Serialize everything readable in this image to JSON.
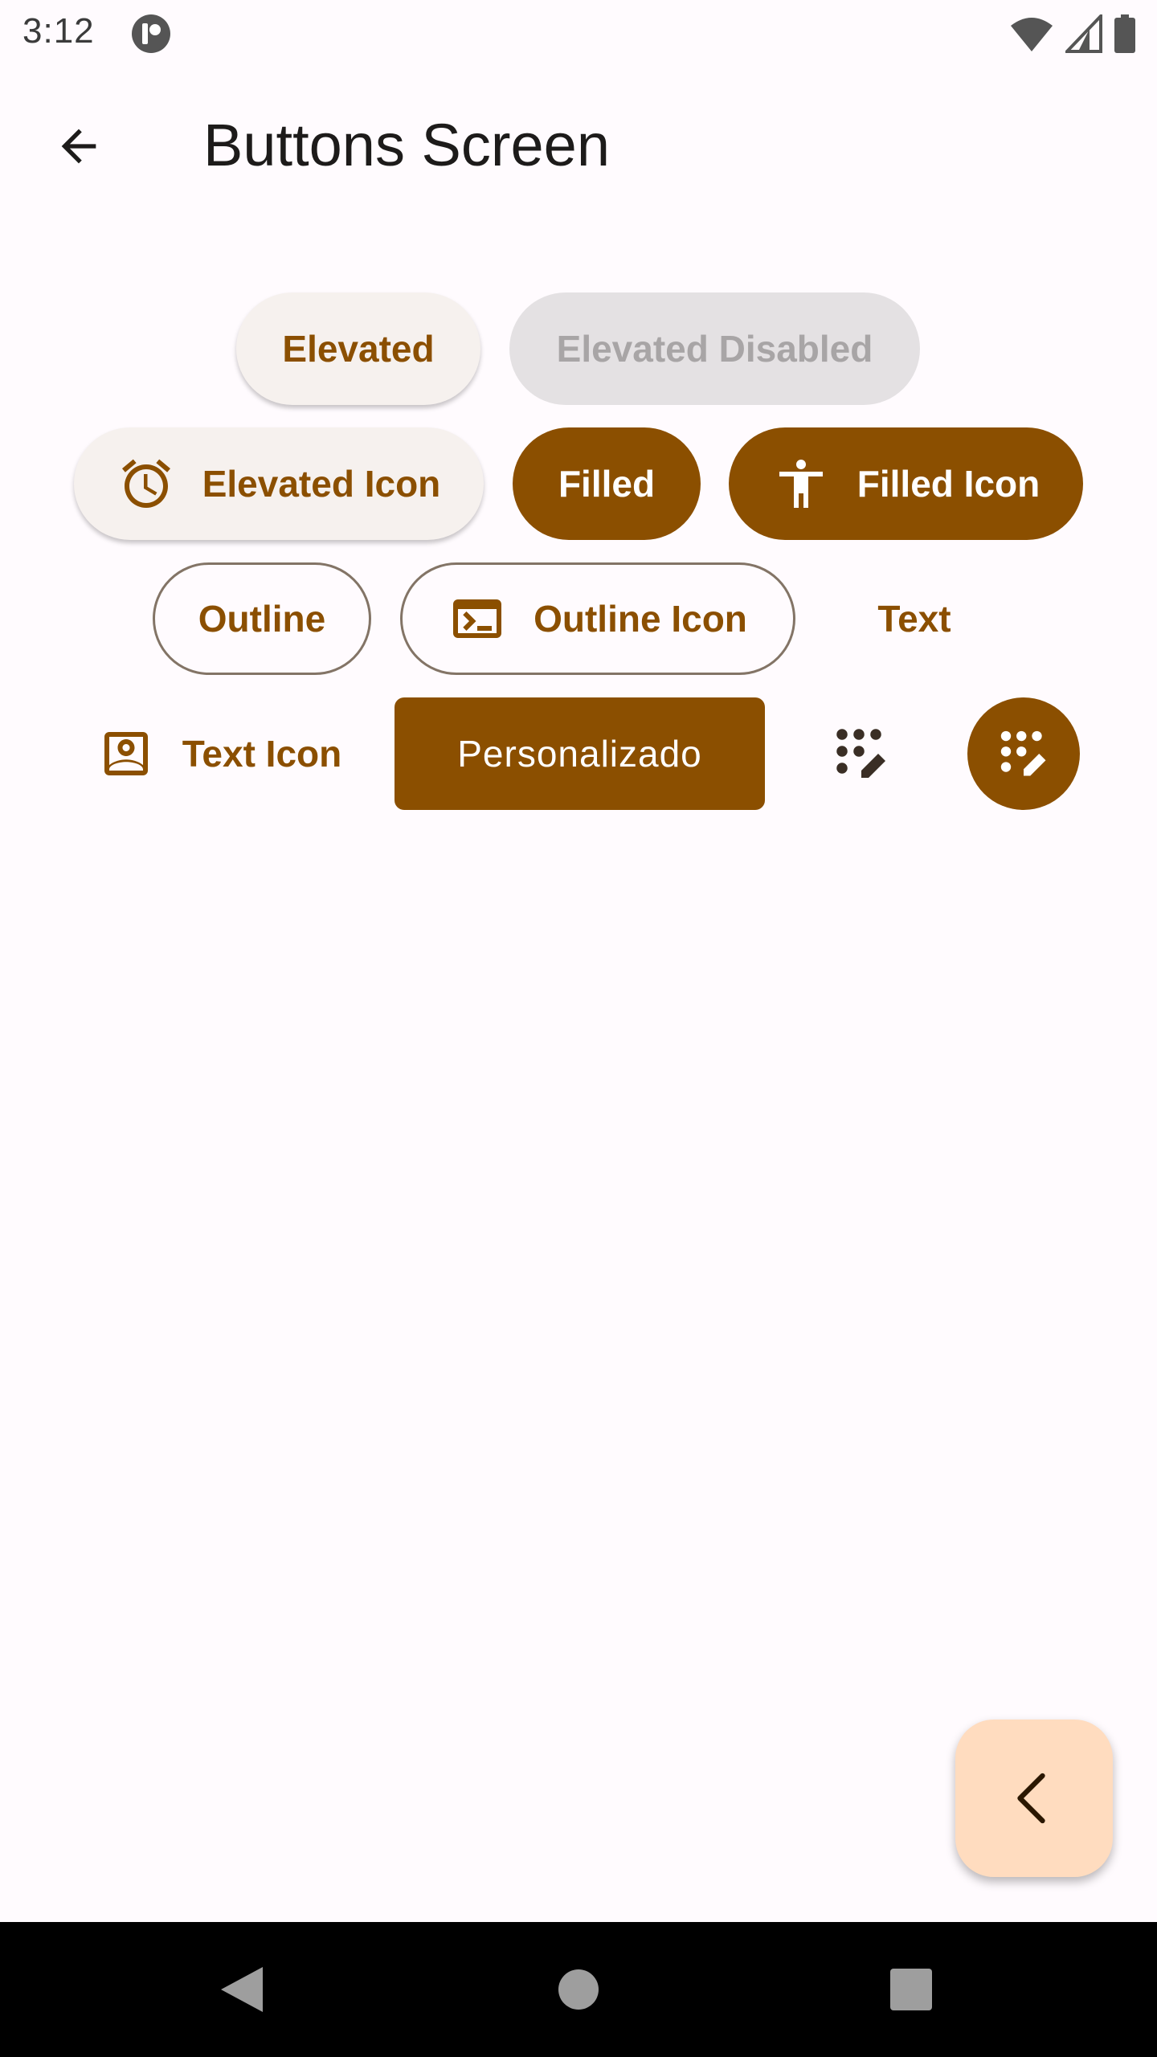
{
  "status_bar": {
    "time": "3:12",
    "icons": [
      "app-notification-icon",
      "wifi-icon",
      "cell-signal-icon",
      "battery-icon"
    ]
  },
  "app_bar": {
    "title": "Buttons Screen",
    "back_icon": "arrow-back-icon"
  },
  "buttons": {
    "elevated": "Elevated",
    "elevated_disabled": "Elevated Disabled",
    "elevated_icon": {
      "label": "Elevated Icon",
      "icon": "alarm-icon"
    },
    "filled": "Filled",
    "filled_icon": {
      "label": "Filled Icon",
      "icon": "accessibility-icon"
    },
    "outline": "Outline",
    "outline_icon": {
      "label": "Outline Icon",
      "icon": "terminal-icon"
    },
    "text": "Text",
    "text_icon": {
      "label": "Text Icon",
      "icon": "account-box-icon"
    },
    "custom": "Personalizado",
    "icon_button": {
      "icon": "dialpad-edit-icon"
    },
    "filled_icon_button": {
      "icon": "dialpad-edit-icon"
    }
  },
  "fab": {
    "icon": "chevron-left-icon"
  },
  "nav_bar": {
    "items": [
      "back-triangle-icon",
      "home-circle-icon",
      "recents-square-icon"
    ]
  },
  "colors": {
    "primary": "#8b4f00",
    "background": "#fffbfe",
    "elevated_surface": "#f6f1ee",
    "disabled_surface": "#e4e1e3",
    "disabled_text": "#a8a5a6",
    "outline": "#837466",
    "fab_container": "#ffdcbf",
    "nav_bar": "#000000"
  }
}
